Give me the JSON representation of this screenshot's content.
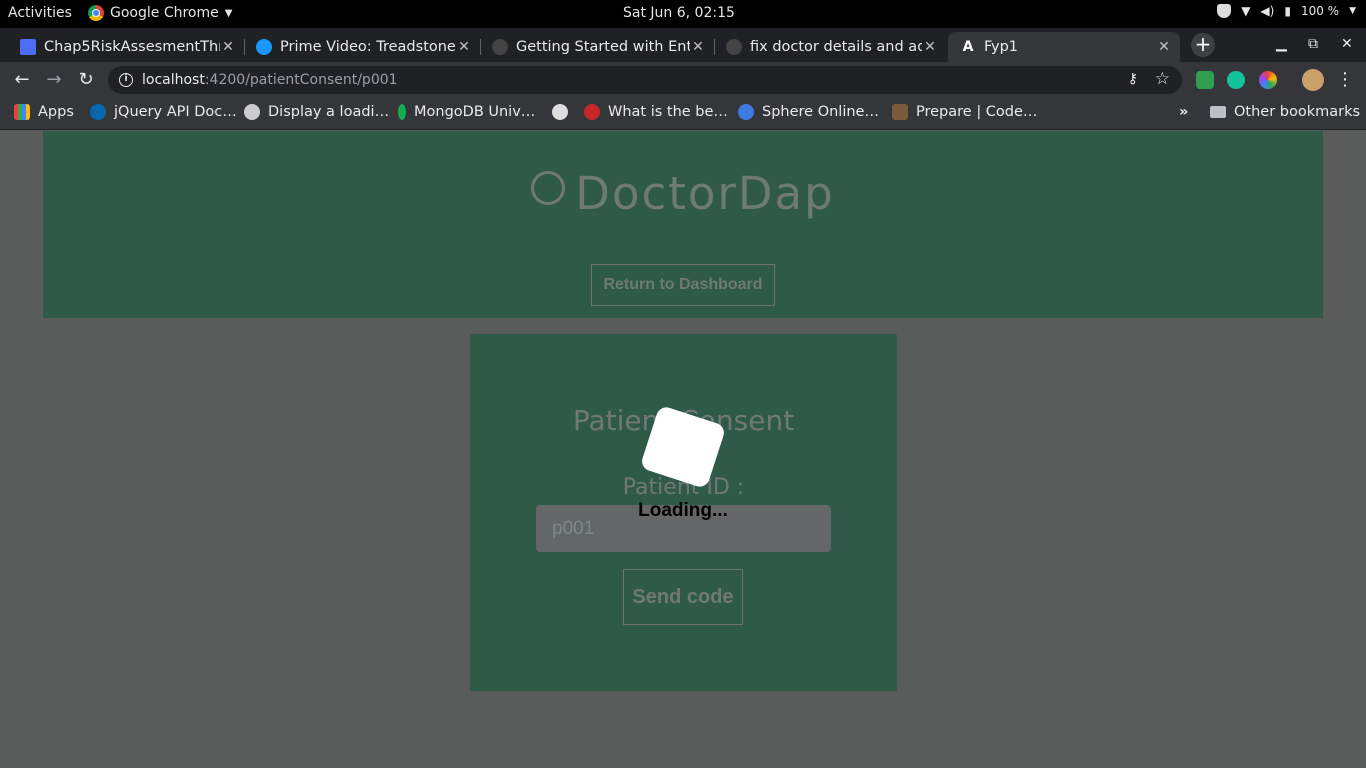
{
  "topbar": {
    "activities": "Activities",
    "app_name": "Google Chrome",
    "clock": "Sat Jun  6, 02:15",
    "battery": "100 %"
  },
  "tabs": [
    {
      "title": "Chap5RiskAssesmentThr",
      "favicon_color": "#4c6ef5"
    },
    {
      "title": "Prime Video: Treadstone",
      "favicon_color": "#1a98ff"
    },
    {
      "title": "Getting Started with Ente",
      "favicon_color": "#444444"
    },
    {
      "title": "fix doctor details and add",
      "favicon_color": "#444444"
    },
    {
      "title": "Fyp1",
      "favicon_color": "#ffffff"
    }
  ],
  "address_bar": {
    "host": "localhost",
    "path": ":4200/patientConsent/p001"
  },
  "bookmarks": [
    {
      "label": "Apps",
      "color": "#e94235"
    },
    {
      "label": "jQuery API Doc…",
      "color": "#0769ad"
    },
    {
      "label": "Display a loadi…",
      "color": "#cccccc"
    },
    {
      "label": "MongoDB Univ…",
      "color": "#13aa52"
    },
    {
      "label": "",
      "color": "#dddddd"
    },
    {
      "label": "What is the be…",
      "color": "#c62828"
    },
    {
      "label": "Sphere Online…",
      "color": "#3f7ae0"
    },
    {
      "label": "Prepare | Code…",
      "color": "#7a5c3a"
    }
  ],
  "bookmarks_overflow": "»",
  "other_bookmarks": "Other bookmarks",
  "page": {
    "brand": "DoctorDap",
    "return_button": "Return to Dashboard",
    "card_title": "Patient Consent",
    "patient_label": "Patient ID :",
    "patient_input_value": "p001",
    "send_button": "Send code",
    "loading_text": "Loading..."
  }
}
